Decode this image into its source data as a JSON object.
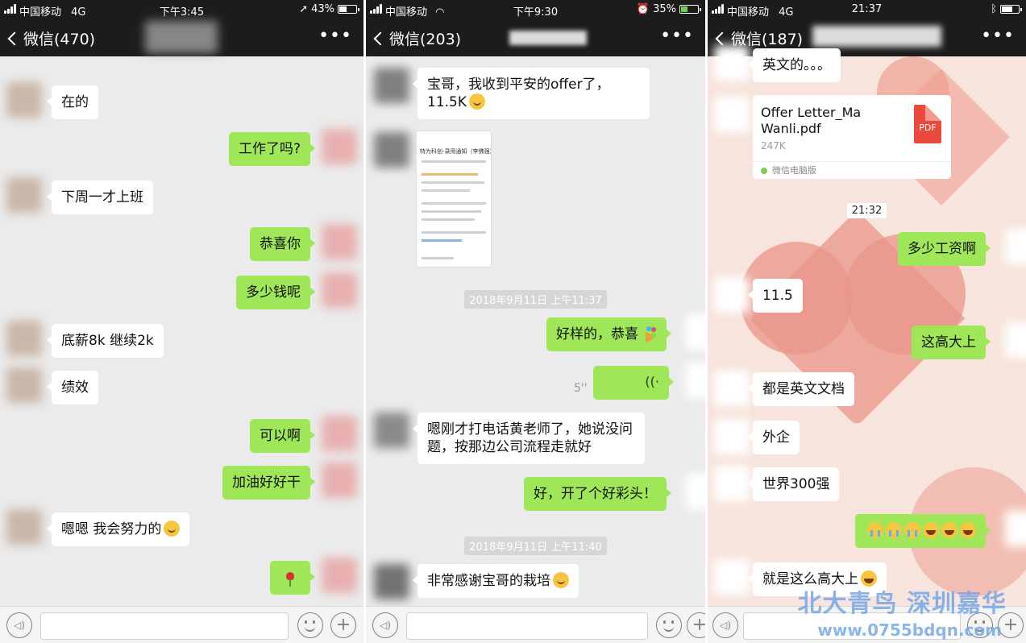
{
  "panels": [
    {
      "status": {
        "carrier": "中国移动",
        "network": "4G",
        "time": "下午3:45",
        "battery": "43%"
      },
      "nav": {
        "back_label": "微信(470)"
      },
      "messages": [
        {
          "text": "在的"
        },
        {
          "text": "工作了吗?"
        },
        {
          "text": "下周一才上班"
        },
        {
          "text": "恭喜你"
        },
        {
          "text": "多少钱呢"
        },
        {
          "text": "底薪8k  继续2k"
        },
        {
          "text": "绩效"
        },
        {
          "text": "可以啊"
        },
        {
          "text": "加油好好干"
        },
        {
          "text": "嗯嗯  我会努力的"
        }
      ]
    },
    {
      "status": {
        "carrier": "中国移动",
        "network": "wifi",
        "time": "下午9:30",
        "battery": "35%"
      },
      "nav": {
        "back_label": "微信(203)"
      },
      "messages": [
        {
          "text": "宝哥，我收到平安的offer了，11.5K"
        },
        {
          "text": "好样的，恭喜"
        },
        {
          "text": "嗯刚才打电话黄老师了，她说没问题，按那边公司流程走就好"
        },
        {
          "text": "好，开了个好彩头！"
        },
        {
          "text": "非常感谢宝哥的栽培"
        }
      ],
      "image_title": "特为科创-录用通知（李佛强）",
      "timestamps": [
        "2018年9月11日 上午11:37",
        "2018年9月11日 上午11:40"
      ],
      "voice_duration": "5''"
    },
    {
      "status": {
        "carrier": "中国移动",
        "network": "4G",
        "time": "21:37",
        "battery": ""
      },
      "nav": {
        "back_label": "微信(187)"
      },
      "messages": [
        {
          "text": "英文的。。。"
        },
        {
          "text": "多少工资啊"
        },
        {
          "text": "11.5"
        },
        {
          "text": "这高大上"
        },
        {
          "text": "都是英文文档"
        },
        {
          "text": "外企"
        },
        {
          "text": "世界300强"
        },
        {
          "text": "就是这么高大上"
        }
      ],
      "file": {
        "name": "Offer Letter_Ma Wanli.pdf",
        "size": "247K",
        "source": "微信电脑版",
        "icon_label": "PDF"
      },
      "timestamps": [
        "21:32"
      ]
    }
  ],
  "watermark": {
    "brand": "北大青鸟 深圳嘉华",
    "url": "www.0755bdqn.com"
  },
  "colors": {
    "sent_bubble": "#9fe659",
    "received_bubble": "#ffffff",
    "navbar": "#1c1c1c",
    "chat_bg": "#ebebeb"
  }
}
